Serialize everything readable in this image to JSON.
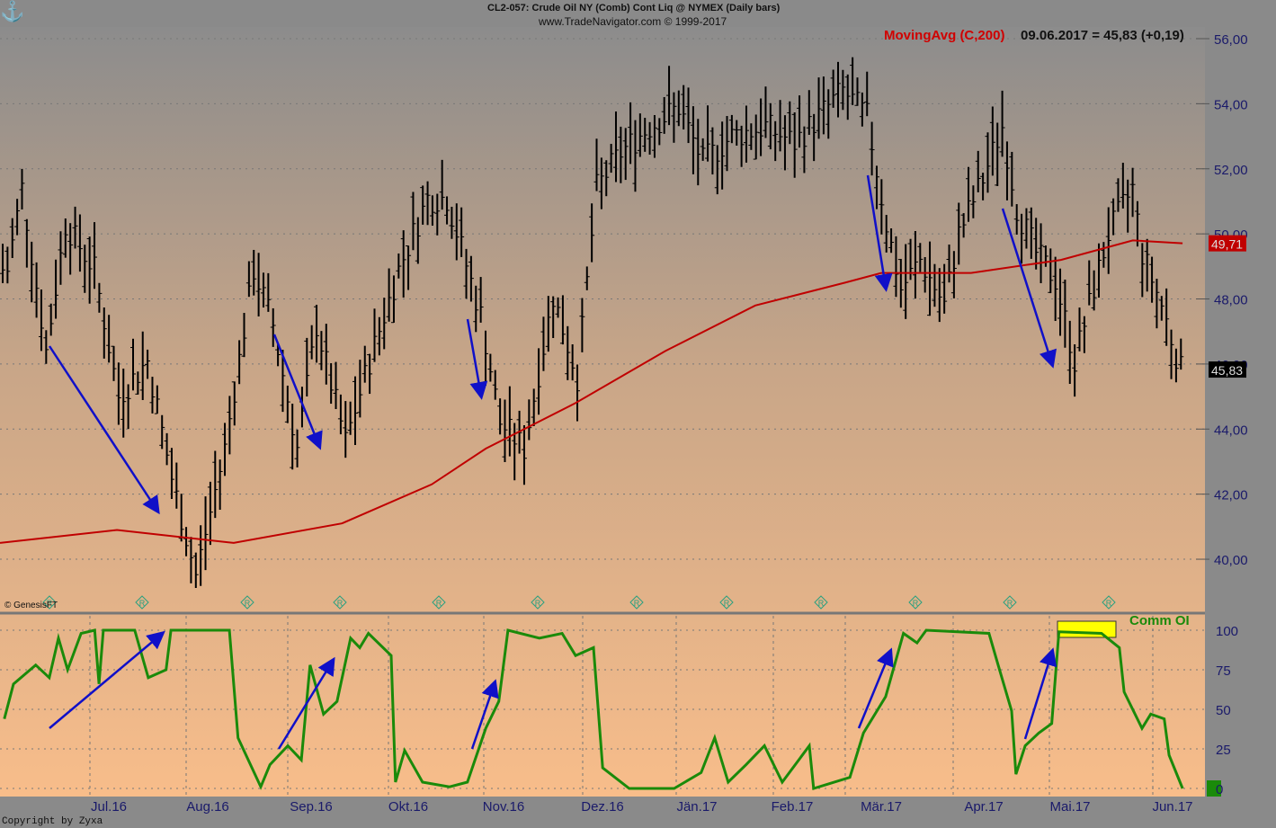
{
  "header": {
    "title": "CL2-057:  Crude Oil NY (Comb) Cont Liq @ NYMEX  (Daily bars)",
    "subtitle": "www.TradeNavigator.com © 1999-2017"
  },
  "legend": {
    "ma_label": "MovingAvg (C,200)",
    "ma_value": "09.06.2017 = 45,83 (+0,19)",
    "indicator_label": "Comm OI"
  },
  "footer": {
    "copyright": "Copyright by Zyxa",
    "genesis": "© GenesisFT"
  },
  "colors": {
    "bars": "#000000",
    "ma": "#c00000",
    "indicator": "#1a8a0a",
    "arrows": "#1010c8",
    "highlight": "#ffff00"
  },
  "chart_data": [
    {
      "type": "line",
      "title": "Crude Oil daily bars with 200-day moving average",
      "ylim": [
        39,
        56.5
      ],
      "yticks": [
        "56,00",
        "54,00",
        "52,00",
        "50,00",
        "48,00",
        "46,00",
        "44,00",
        "42,00",
        "40,00"
      ],
      "xticks": [
        "Jul.16",
        "Aug.16",
        "Sep.16",
        "Okt.16",
        "Nov.16",
        "Dez.16",
        "Jän.17",
        "Feb.17",
        "Mär.17",
        "Apr.17",
        "Mai.17",
        "Jun.17"
      ],
      "last_price_label": "45,83",
      "ma_last_label": "49,71",
      "close_series": [
        [
          1,
          48.9
        ],
        [
          4,
          51.4
        ],
        [
          9,
          46.4
        ],
        [
          13,
          50.3
        ],
        [
          19,
          48.9
        ],
        [
          24,
          45.0
        ],
        [
          30,
          46.1
        ],
        [
          35,
          42.5
        ],
        [
          40,
          39.5
        ],
        [
          46,
          43.4
        ],
        [
          52,
          48.9
        ],
        [
          56,
          47.2
        ],
        [
          61,
          43.4
        ],
        [
          65,
          47.2
        ],
        [
          71,
          43.6
        ],
        [
          76,
          46.1
        ],
        [
          82,
          48.9
        ],
        [
          88,
          51.1
        ],
        [
          92,
          51.1
        ],
        [
          99,
          47.5
        ],
        [
          103,
          44.2
        ],
        [
          108,
          43.4
        ],
        [
          114,
          48.1
        ],
        [
          119,
          45.6
        ],
        [
          123,
          51.4
        ],
        [
          128,
          52.5
        ],
        [
          134,
          53.3
        ],
        [
          140,
          53.9
        ],
        [
          145,
          52.2
        ],
        [
          151,
          53.0
        ],
        [
          158,
          53.3
        ],
        [
          164,
          52.8
        ],
        [
          169,
          53.6
        ],
        [
          174,
          54.4
        ],
        [
          179,
          53.6
        ],
        [
          183,
          50.3
        ],
        [
          186,
          48.3
        ],
        [
          190,
          49.2
        ],
        [
          195,
          47.8
        ],
        [
          198,
          50.0
        ],
        [
          203,
          51.7
        ],
        [
          207,
          53.3
        ],
        [
          210,
          50.8
        ],
        [
          214,
          49.4
        ],
        [
          218,
          48.6
        ],
        [
          222,
          46.1
        ],
        [
          225,
          47.8
        ],
        [
          229,
          50.0
        ],
        [
          234,
          51.4
        ],
        [
          236,
          49.4
        ],
        [
          240,
          47.8
        ],
        [
          244,
          45.8
        ]
      ],
      "ma200_series": [
        [
          0,
          40.5
        ],
        [
          24.2,
          40.9
        ],
        [
          48.4,
          40.5
        ],
        [
          70.8,
          41.1
        ],
        [
          89.4,
          42.3
        ],
        [
          100.6,
          43.4
        ],
        [
          119.2,
          44.8
        ],
        [
          137.8,
          46.4
        ],
        [
          156.4,
          47.8
        ],
        [
          175,
          48.5
        ],
        [
          182.5,
          48.8
        ],
        [
          201.1,
          48.8
        ],
        [
          219.7,
          49.2
        ],
        [
          234.6,
          49.8
        ],
        [
          244.9,
          49.71
        ]
      ]
    },
    {
      "type": "line",
      "title": "Comm OI",
      "ylim": [
        0,
        100
      ],
      "yticks": [
        "100",
        "75",
        "50",
        "25",
        "0"
      ],
      "series": [
        [
          0.9,
          44
        ],
        [
          2.8,
          66
        ],
        [
          7.4,
          78
        ],
        [
          10.2,
          70
        ],
        [
          12.1,
          95
        ],
        [
          14,
          75
        ],
        [
          16.8,
          98
        ],
        [
          19.6,
          100
        ],
        [
          20.5,
          66
        ],
        [
          21.4,
          100
        ],
        [
          27.9,
          100
        ],
        [
          30.7,
          70
        ],
        [
          34.4,
          75
        ],
        [
          35.4,
          100
        ],
        [
          47.5,
          100
        ],
        [
          49.3,
          32
        ],
        [
          54,
          1
        ],
        [
          55.9,
          15
        ],
        [
          59.6,
          27
        ],
        [
          62.4,
          18
        ],
        [
          64.2,
          78
        ],
        [
          67,
          47
        ],
        [
          69.8,
          55
        ],
        [
          72.6,
          95
        ],
        [
          74.5,
          89
        ],
        [
          76.3,
          98
        ],
        [
          81,
          84
        ],
        [
          81.9,
          4
        ],
        [
          83.8,
          24
        ],
        [
          87.5,
          4
        ],
        [
          93.1,
          1
        ],
        [
          96.8,
          4
        ],
        [
          100.6,
          38
        ],
        [
          103.3,
          55
        ],
        [
          105.2,
          100
        ],
        [
          111.7,
          95
        ],
        [
          116.4,
          98
        ],
        [
          119.2,
          84
        ],
        [
          122.9,
          89
        ],
        [
          124.8,
          13
        ],
        [
          130.3,
          0
        ],
        [
          139.6,
          0
        ],
        [
          145.2,
          10
        ],
        [
          148,
          32
        ],
        [
          150.8,
          4
        ],
        [
          154.5,
          15
        ],
        [
          158.3,
          27
        ],
        [
          162,
          4
        ],
        [
          167.6,
          27
        ],
        [
          168.5,
          0
        ],
        [
          176,
          7
        ],
        [
          178.8,
          35
        ],
        [
          183.4,
          58
        ],
        [
          187.1,
          98
        ],
        [
          189.9,
          92
        ],
        [
          191.8,
          100
        ],
        [
          204.8,
          98
        ],
        [
          206.7,
          78
        ],
        [
          209.5,
          49
        ],
        [
          210.4,
          9
        ],
        [
          212.3,
          27
        ],
        [
          215.1,
          35
        ],
        [
          217.8,
          41
        ],
        [
          219.3,
          99
        ],
        [
          228.1,
          98
        ],
        [
          231.8,
          89
        ],
        [
          232.8,
          61
        ],
        [
          236.5,
          38
        ],
        [
          238.3,
          47
        ],
        [
          241.1,
          44
        ],
        [
          242.1,
          21
        ],
        [
          244.9,
          0
        ]
      ]
    }
  ]
}
